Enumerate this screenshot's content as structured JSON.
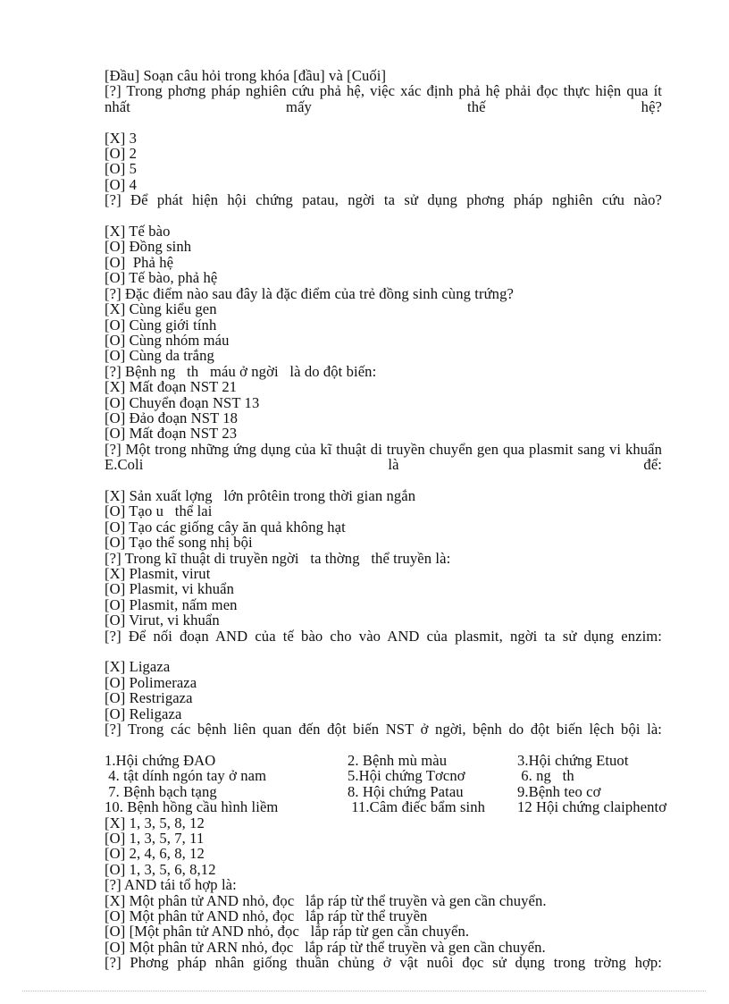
{
  "document": {
    "header_line": "[Đầu] Soạn câu hỏi trong khóa [đầu] và [Cuối]",
    "blocks": [
      {
        "type": "question",
        "text": "[?] Trong phơng   pháp nghiên cứu phả hệ, việc xác định phả hệ phải đọc   thực hiện qua ít nhất mấy thế hệ?"
      },
      {
        "type": "answer",
        "text": "[X] 3"
      },
      {
        "type": "answer",
        "text": "[O] 2"
      },
      {
        "type": "answer",
        "text": "[O] 5"
      },
      {
        "type": "answer",
        "text": "[O] 4"
      },
      {
        "type": "question",
        "text": "[?] Để phát hiện hội chứng patau, ngời   ta sử dụng phơng   pháp nghiên cứu nào?"
      },
      {
        "type": "answer",
        "text": "[X] Tế bào"
      },
      {
        "type": "answer",
        "text": "[O] Đồng sinh"
      },
      {
        "type": "answer",
        "text": "[O]  Phả hệ"
      },
      {
        "type": "answer",
        "text": "[O] Tế bào, phả hệ"
      },
      {
        "type": "question-short",
        "text": "[?] Đặc điểm nào sau đây là đặc điểm của trẻ đồng sinh cùng trứng?"
      },
      {
        "type": "answer",
        "text": "[X] Cùng kiểu gen"
      },
      {
        "type": "answer",
        "text": "[O] Cùng giới tính"
      },
      {
        "type": "answer",
        "text": "[O] Cùng nhóm máu"
      },
      {
        "type": "answer",
        "text": "[O] Cùng da trắng"
      },
      {
        "type": "question-short",
        "text": "[?] Bệnh ng   th   máu ở ngời   là do đột biến:"
      },
      {
        "type": "answer",
        "text": "[X] Mất đoạn NST 21"
      },
      {
        "type": "answer",
        "text": "[O] Chuyển đoạn NST 13"
      },
      {
        "type": "answer",
        "text": "[O] Đảo đoạn NST 18"
      },
      {
        "type": "answer",
        "text": "[O] Mất đoạn NST 23"
      },
      {
        "type": "question",
        "text": "[?] Một trong những ứng dụng của kĩ thuật di truyền chuyển gen qua plasmit sang vi khuẩn E.Coli là để:"
      },
      {
        "type": "answer",
        "text": "[X] Sản xuất lợng   lớn prôtêin trong thời gian ngắn"
      },
      {
        "type": "answer",
        "text": "[O] Tạo u   thể lai"
      },
      {
        "type": "answer",
        "text": "[O] Tạo các giống cây ăn quả không hạt"
      },
      {
        "type": "answer",
        "text": "[O] Tạo thể song nhị bội"
      },
      {
        "type": "question-short",
        "text": "[?] Trong kĩ thuật di truyền ngời   ta thờng   thể truyền là:"
      },
      {
        "type": "answer",
        "text": "[X] Plasmit, virut"
      },
      {
        "type": "answer",
        "text": "[O] Plasmit, vi khuẩn"
      },
      {
        "type": "answer",
        "text": "[O] Plasmit, nấm men"
      },
      {
        "type": "answer",
        "text": "[O] Virut, vi khuẩn"
      },
      {
        "type": "question",
        "text": "[?] Để nối đoạn AND của tế bào cho vào AND của plasmit, ngời   ta sử dụng enzim:"
      },
      {
        "type": "answer",
        "text": "[X] Ligaza"
      },
      {
        "type": "answer",
        "text": "[O] Polimeraza"
      },
      {
        "type": "answer",
        "text": "[O] Restrigaza"
      },
      {
        "type": "answer",
        "text": "[O] Religaza"
      },
      {
        "type": "question",
        "text": "[?] Trong các bệnh liên quan đến đột biến NST ở ngời,   bệnh do đột biến lệch bội là:"
      },
      {
        "type": "grid",
        "rows": [
          [
            "1.Hội chứng ĐAO",
            "2. Bệnh mù màu",
            "3.Hội chứng Etuot"
          ],
          [
            " 4. tật dính ngón tay ở nam",
            "5.Hội chứng Tơcnơ",
            " 6. ng   th"
          ],
          [
            " 7. Bệnh bạch tạng",
            "8. Hội chứng Patau",
            "9.Bệnh teo cơ"
          ],
          [
            "10. Bệnh hồng cầu hình liềm",
            " 11.Câm điếc bẩm sinh",
            "12 Hội chứng claiphentơ"
          ]
        ]
      },
      {
        "type": "answer",
        "text": "[X] 1, 3, 5, 8, 12"
      },
      {
        "type": "answer",
        "text": "[O] 1, 3, 5, 7, 11"
      },
      {
        "type": "answer",
        "text": "[O] 2, 4, 6, 8, 12"
      },
      {
        "type": "answer",
        "text": "[O] 1, 3, 5, 6, 8,12"
      },
      {
        "type": "question-short",
        "text": "[?] AND tái tổ hợp là:"
      },
      {
        "type": "answer",
        "text": "[X] Một phân tử AND nhỏ, đọc   lắp ráp từ thể truyền và gen cần chuyển."
      },
      {
        "type": "answer",
        "text": "[O] Một phân tử AND nhỏ, đọc   lắp ráp từ thể truyền"
      },
      {
        "type": "answer",
        "text": "[O] [Một phân tử AND nhỏ, đọc   lắp ráp từ gen cần chuyển."
      },
      {
        "type": "answer",
        "text": "[O] Một phân tử ARN nhỏ, đọc   lắp ráp từ thể truyền và gen cần chuyển."
      },
      {
        "type": "question",
        "text": "[?] Phơng   pháp nhân giống thuần chủng ở vật nuôi đọc   sử dụng trong trờng hợp:"
      }
    ]
  }
}
